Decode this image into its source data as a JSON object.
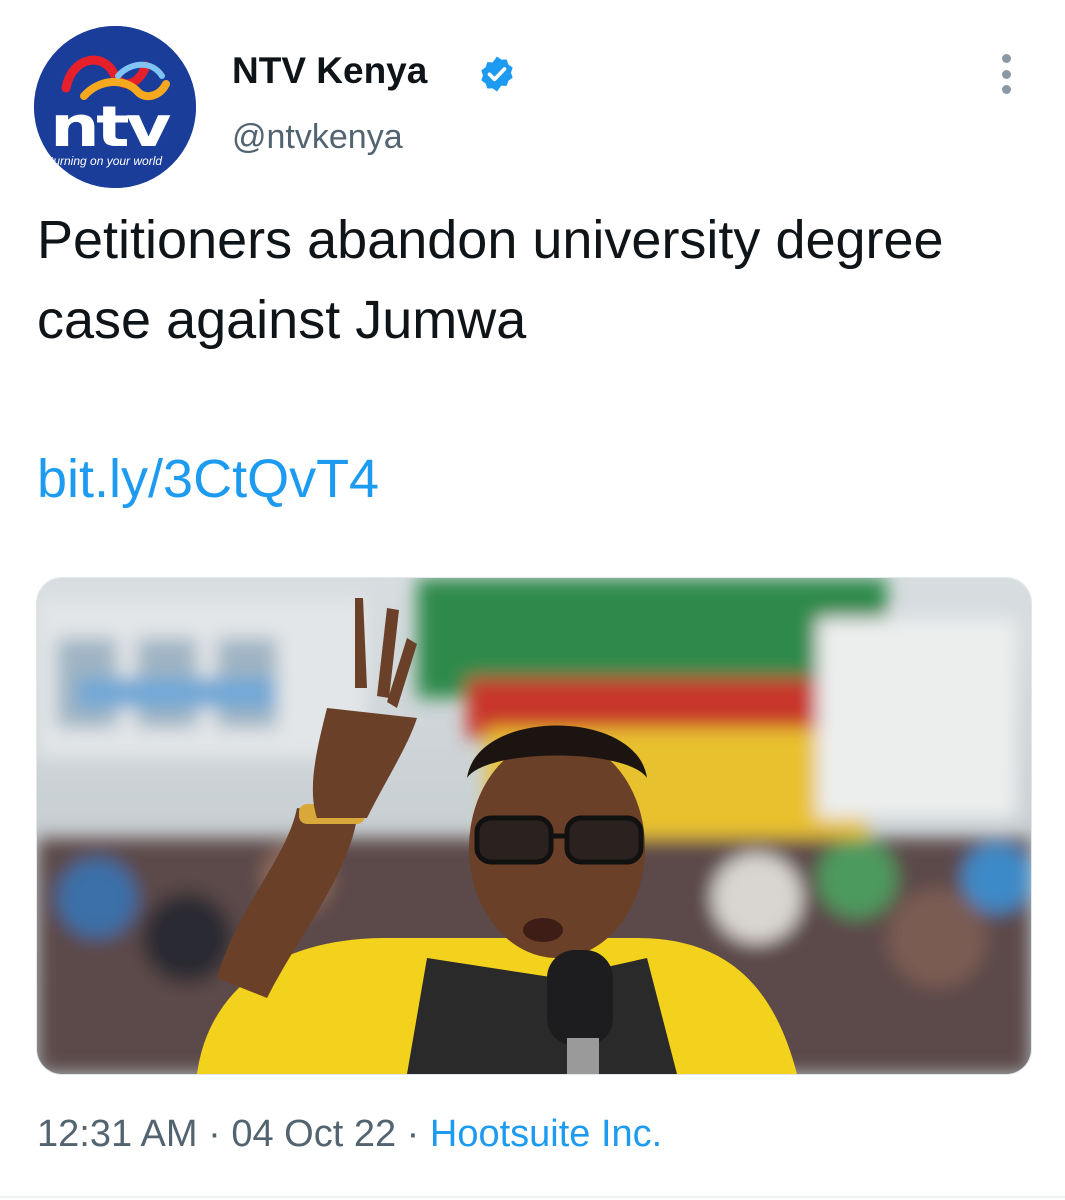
{
  "tweet": {
    "author": {
      "display_name": "NTV Kenya",
      "handle": "@ntvkenya",
      "verified": true,
      "avatar": {
        "brand": "ntv",
        "tagline": "turning on your world"
      }
    },
    "text": "Petitioners abandon university degree case against Jumwa",
    "link": "bit.ly/3CtQvT4",
    "media": {
      "icon": "photo"
    },
    "meta": {
      "time": "12:31 AM",
      "separator": "·",
      "date": "04 Oct 22",
      "source": "Hootsuite Inc."
    }
  },
  "colors": {
    "link": "#1d9bf0",
    "secondary_text": "#536471",
    "verified_badge": "#1d9bf0",
    "avatar_bg": "#1a3d9a"
  },
  "icons": {
    "verified": "verified-badge-icon",
    "more": "more-vertical-icon"
  }
}
